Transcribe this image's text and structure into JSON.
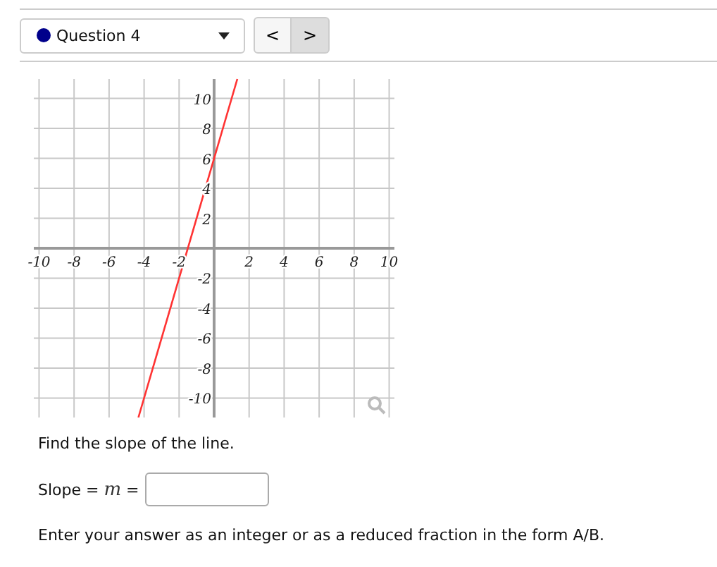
{
  "question_select": {
    "label": "Question 4",
    "color": "#00008b"
  },
  "nav": {
    "prev": "<",
    "next": ">"
  },
  "graph": {
    "chart_data": {
      "type": "line",
      "x": [
        -4.325,
        1.325
      ],
      "series": [
        {
          "color": "#ff3333",
          "values": [
            -11.3,
            11.3
          ]
        }
      ],
      "grid": true,
      "xlim": [
        -10.3,
        10.3
      ],
      "ylim": [
        -11.3,
        11.3
      ],
      "xticks": [
        -10,
        -8,
        -6,
        -4,
        -2,
        2,
        4,
        6,
        8,
        10
      ],
      "yticks": [
        -10,
        -8,
        -6,
        -4,
        -2,
        2,
        4,
        6,
        8,
        10
      ]
    }
  },
  "prompt": "Find the slope of the line.",
  "answer": {
    "label": "Slope = ",
    "math": "m",
    "equals": "="
  },
  "instructions": "Enter your answer as an integer or as a reduced fraction in the form A/B."
}
